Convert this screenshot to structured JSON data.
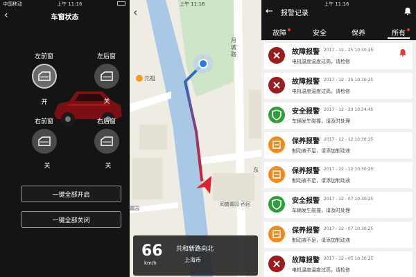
{
  "window_panel": {
    "carrier": "中国移动",
    "time": "上午 11:16",
    "title": "车窗状态",
    "windows": [
      {
        "label": "左前窗",
        "state": "开",
        "open": true
      },
      {
        "label": "左后窗",
        "state": "关",
        "open": false
      },
      {
        "label": "右前窗",
        "state": "关",
        "open": false
      },
      {
        "label": "右后窗",
        "state": "关",
        "open": false
      }
    ],
    "open_all_label": "一键全部开启",
    "close_all_label": "一键全部关闭"
  },
  "map_panel": {
    "time": "上午 11:16",
    "labels": {
      "road_vertical": "月城路",
      "poi": "元祖",
      "east": "东",
      "district": "同盛嘉园-西区",
      "bottom_poi": "嘉园"
    },
    "speed": "66",
    "speed_unit": "km/h",
    "road_name": "共和新路向北",
    "city": "上海市"
  },
  "alarm_panel": {
    "time": "上午 11:16",
    "title": "报警记录",
    "tabs": [
      {
        "label": "故障",
        "dot": true
      },
      {
        "label": "安全",
        "dot": false
      },
      {
        "label": "保养",
        "dot": false
      },
      {
        "label": "所有",
        "dot": true,
        "active": true
      }
    ],
    "records": [
      {
        "type": "fault",
        "title": "故障报警",
        "date": "2017 - 12 - 25   10:30:25",
        "desc": "电机温度温度过高，请检修",
        "bell": true
      },
      {
        "type": "fault",
        "title": "故障报警",
        "date": "2017 - 12 - 25   10:30:25",
        "desc": "电机温度温度过高，请检修",
        "bell": false
      },
      {
        "type": "safety",
        "title": "安全报警",
        "date": "2017 - 12 - 23   10:34:45",
        "desc": "车辆发生碰撞，请及时处理",
        "bell": false
      },
      {
        "type": "maintenance",
        "title": "保养报警",
        "date": "2017 - 12 - 12   10:30:25",
        "desc": "制动液不足，请添加制动液",
        "bell": false
      },
      {
        "type": "maintenance",
        "title": "保养报警",
        "date": "2017 - 12 - 12   10:30:25",
        "desc": "制动液不足，请添加制动液",
        "bell": false
      },
      {
        "type": "safety",
        "title": "安全报警",
        "date": "2017 - 12 - 07   10:30:25",
        "desc": "车辆发生碰撞，请及时处理",
        "bell": false
      },
      {
        "type": "maintenance",
        "title": "保养报警",
        "date": "2017 - 12 - 07   10:30:25",
        "desc": "制动液不足，请添加制动液",
        "bell": false
      },
      {
        "type": "fault",
        "title": "故障报警",
        "date": "2017 - 12 - 05   10:30:25",
        "desc": "电机温度温度过高，请检修",
        "bell": false
      }
    ],
    "colors": {
      "fault": "#9b1c1c",
      "safety": "#2e9e3a",
      "maintenance": "#f08a1c",
      "accent": "#e53935"
    }
  }
}
